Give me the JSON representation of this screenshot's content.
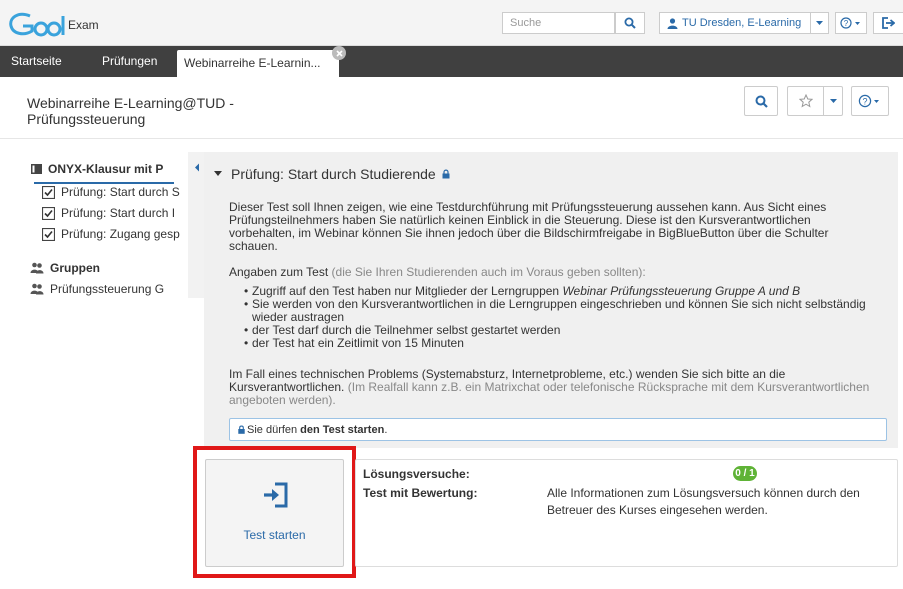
{
  "header": {
    "logo_text": "Exam",
    "search_placeholder": "Suche",
    "user_label": "TU Dresden, E-Learning"
  },
  "nav": {
    "start": "Startseite",
    "exams": "Prüfungen",
    "active_tab": "Webinarreihe E-Learnin..."
  },
  "page": {
    "title_line1": "Webinarreihe E-Learning@TUD -",
    "title_line2": "Prüfungssteuerung"
  },
  "tree": {
    "root": "ONYX-Klausur mit P",
    "items": [
      "Prüfung: Start durch S",
      "Prüfung: Start durch I",
      "Prüfung: Zugang gesp"
    ],
    "groups": "Gruppen",
    "group_item": "Prüfungssteuerung G"
  },
  "main": {
    "section_title": "Prüfung: Start durch Studierende",
    "intro": "Dieser Test soll Ihnen zeigen, wie eine Testdurchführung mit Prüfungssteuerung aussehen kann. Aus Sicht eines Prüfungsteilnehmers haben Sie natürlich keinen Einblick in die Steuerung. Diese ist den Kursverantwortlichen vorbehalten, im Webinar können Sie ihnen jedoch über die Bildschirmfreigabe in BigBlueButton über die Schulter schauen.",
    "test_info_label": "Angaben zum Test",
    "test_info_hint": "(die Sie Ihren Studierenden auch im Voraus geben sollten):",
    "bullet1_pre": "Zugriff auf den Test haben nur Mitglieder der Lerngruppen ",
    "bullet1_em": "Webinar Prüfungssteuerung Gruppe A und B",
    "bullet2": "Sie werden von den Kursverantwortlichen in die Lerngruppen eingeschrieben und können Sie sich nicht selbständig wieder austragen",
    "bullet3": "der Test darf durch die Teilnehmer selbst gestartet werden",
    "bullet4": "der Test hat ein Zeitlimit von 15 Minuten",
    "problem_text": "Im Fall eines technischen Problems (Systemabsturz, Internetprobleme, etc.) wenden Sie sich bitte an die Kursverantwortlichen.",
    "problem_hint": "(Im Realfall kann z.B. ein Matrixchat oder telefonische Rücksprache mit dem Kursverantwortlichen angeboten werden).",
    "notice_pre": "Sie dürfen ",
    "notice_bold": "den Test starten",
    "notice_post": "."
  },
  "start": {
    "button_label": "Test starten"
  },
  "info": {
    "attempts_label": "Lösungsversuche:",
    "attempts_badge": "0 / 1",
    "graded_label": "Test mit Bewertung:",
    "graded_text_line1": "Alle Informationen zum Lösungsversuch können durch den",
    "graded_text_line2": "Betreuer des Kurses eingesehen werden."
  },
  "colors": {
    "accent": "#2a6aa8",
    "nav_bg": "#404040",
    "highlight": "#e01818",
    "badge": "#5fb336"
  }
}
